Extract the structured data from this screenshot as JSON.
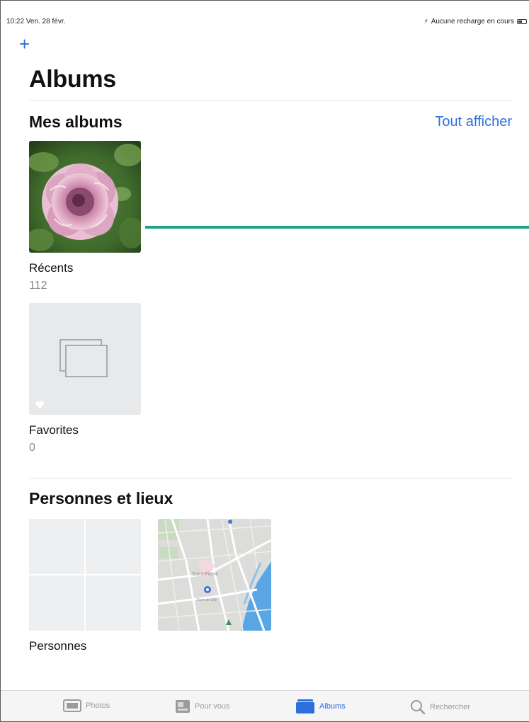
{
  "status_bar": {
    "time": "10:22",
    "date": "Ven. 28 févr.",
    "charging": "Aucune recharge en cours"
  },
  "header": {
    "add_label": "+",
    "title": "Albums"
  },
  "my_albums": {
    "title": "Mes albums",
    "see_all": "Tout afficher",
    "items": [
      {
        "label": "Récents",
        "count": "112"
      },
      {
        "label": "Favorites",
        "count": "0"
      }
    ]
  },
  "people_places": {
    "title": "Personnes et lieux",
    "people_label": "Personnes",
    "map_labels": [
      "Saint-Pierre",
      "Gare de Lille"
    ]
  },
  "tab_bar": {
    "tabs": [
      {
        "label": "Photos",
        "icon": "photos-icon"
      },
      {
        "label": "Pour vous",
        "icon": "for-you-icon"
      },
      {
        "label": "Albums",
        "icon": "albums-icon",
        "active": true
      },
      {
        "label": "Rechercher",
        "icon": "search-icon"
      }
    ]
  },
  "colors": {
    "accent": "#2a6fdb",
    "annotation_line": "#1fa184"
  }
}
